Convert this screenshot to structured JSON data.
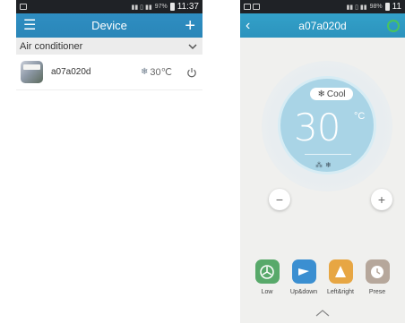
{
  "left_phone": {
    "statusbar": {
      "time": "11:37",
      "battery": "97%"
    },
    "appbar": {
      "title": "Device",
      "menu_icon": "menu-icon",
      "add_icon": "plus-icon"
    },
    "section": {
      "label": "Air conditioner"
    },
    "device": {
      "name": "a07a020d",
      "temp": "30℃",
      "mode_icon": "snowflake-icon"
    }
  },
  "right_phone": {
    "statusbar": {
      "time": "11",
      "battery": "98%"
    },
    "appbar": {
      "title": "a07a020d"
    },
    "mode": "Cool",
    "temperature": "30",
    "unit": "°C",
    "buttons": {
      "minus": "−",
      "plus": "+"
    },
    "functions": [
      {
        "label": "Low",
        "color": "#58a96a"
      },
      {
        "label": "Up&down",
        "color": "#3b8fd1"
      },
      {
        "label": "Left&right",
        "color": "#e7a643"
      },
      {
        "label": "Prese",
        "color": "#b6a79b"
      }
    ]
  },
  "colors": {
    "accent": "#2f8ec2",
    "dial": "#a9d4e6",
    "power_on": "#49c45c"
  }
}
